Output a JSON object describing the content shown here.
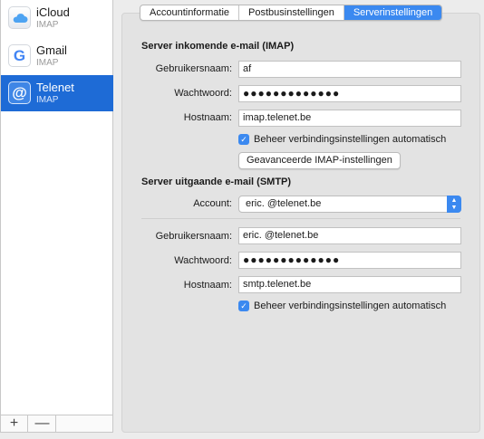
{
  "accounts": [
    {
      "name": "iCloud",
      "type": "IMAP",
      "icon": "icloud-icon"
    },
    {
      "name": "Gmail",
      "type": "IMAP",
      "icon": "gmail-icon",
      "glyph": "G"
    },
    {
      "name": "Telenet",
      "type": "IMAP",
      "icon": "at-icon",
      "glyph": "@",
      "selected": true
    }
  ],
  "sidebar_controls": {
    "add": "+",
    "remove": "—"
  },
  "tabs": [
    {
      "label": "Accountinformatie"
    },
    {
      "label": "Postbusinstellingen"
    },
    {
      "label": "Serverinstellingen",
      "active": true
    }
  ],
  "incoming": {
    "heading": "Server inkomende e-mail (IMAP)",
    "username_label": "Gebruikersnaam:",
    "username": "af",
    "password_label": "Wachtwoord:",
    "password": "●●●●●●●●●●●●●",
    "host_label": "Hostnaam:",
    "host": "imap.telenet.be",
    "auto_label": "Beheer verbindingsinstellingen automatisch",
    "advanced_button": "Geavanceerde IMAP-instellingen"
  },
  "outgoing": {
    "heading": "Server uitgaande e-mail (SMTP)",
    "account_label": "Account:",
    "account_value": "eric.                    @telenet.be",
    "username_label": "Gebruikersnaam:",
    "username": "eric.                    @telenet.be",
    "password_label": "Wachtwoord:",
    "password": "●●●●●●●●●●●●●",
    "host_label": "Hostnaam:",
    "host": "smtp.telenet.be",
    "auto_label": "Beheer verbindingsinstellingen automatisch"
  },
  "colors": {
    "accent": "#3b89f0",
    "selection": "#1e6bd6"
  }
}
